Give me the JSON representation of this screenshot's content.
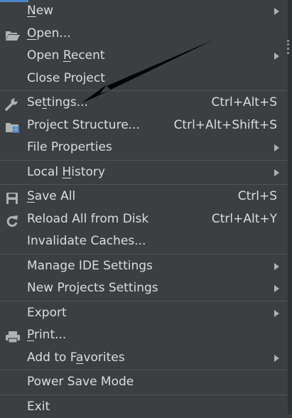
{
  "menu": {
    "items": [
      {
        "pre": "",
        "ul": "N",
        "post": "ew",
        "shortcut": "",
        "submenu": true,
        "icon": "none"
      },
      {
        "pre": "",
        "ul": "O",
        "post": "pen...",
        "shortcut": "",
        "submenu": false,
        "icon": "folder-open-icon"
      },
      {
        "pre": "Open ",
        "ul": "R",
        "post": "ecent",
        "shortcut": "",
        "submenu": true,
        "icon": "none"
      },
      {
        "pre": "Close Project",
        "ul": "",
        "post": "",
        "shortcut": "",
        "submenu": false,
        "icon": "none"
      },
      {
        "pre": "Se",
        "ul": "t",
        "post": "tings...",
        "shortcut": "Ctrl+Alt+S",
        "submenu": false,
        "icon": "wrench-icon"
      },
      {
        "pre": "Project Structure...",
        "ul": "",
        "post": "",
        "shortcut": "Ctrl+Alt+Shift+S",
        "submenu": false,
        "icon": "project-structure-icon"
      },
      {
        "pre": "File Properties",
        "ul": "",
        "post": "",
        "shortcut": "",
        "submenu": true,
        "icon": "none"
      },
      {
        "pre": "Local ",
        "ul": "H",
        "post": "istory",
        "shortcut": "",
        "submenu": true,
        "icon": "none"
      },
      {
        "pre": "",
        "ul": "S",
        "post": "ave All",
        "shortcut": "Ctrl+S",
        "submenu": false,
        "icon": "save-icon"
      },
      {
        "pre": "Reload All from Disk",
        "ul": "",
        "post": "",
        "shortcut": "Ctrl+Alt+Y",
        "submenu": false,
        "icon": "reload-icon"
      },
      {
        "pre": "Invalidate Caches...",
        "ul": "",
        "post": "",
        "shortcut": "",
        "submenu": false,
        "icon": "none"
      },
      {
        "pre": "Manage IDE Settings",
        "ul": "",
        "post": "",
        "shortcut": "",
        "submenu": true,
        "icon": "none"
      },
      {
        "pre": "New Projects Settings",
        "ul": "",
        "post": "",
        "shortcut": "",
        "submenu": true,
        "icon": "none"
      },
      {
        "pre": "Export",
        "ul": "",
        "post": "",
        "shortcut": "",
        "submenu": true,
        "icon": "none"
      },
      {
        "pre": "",
        "ul": "P",
        "post": "rint...",
        "shortcut": "",
        "submenu": false,
        "icon": "printer-icon"
      },
      {
        "pre": "Add to F",
        "ul": "a",
        "post": "vorites",
        "shortcut": "",
        "submenu": true,
        "icon": "none"
      },
      {
        "pre": "Power Save Mode",
        "ul": "",
        "post": "",
        "shortcut": "",
        "submenu": false,
        "icon": "none"
      },
      {
        "pre": "E",
        "ul": "",
        "post": "xit",
        "shortcut": "",
        "submenu": false,
        "icon": "none"
      }
    ]
  },
  "colors": {
    "background": "#3c3f41",
    "text": "#dcdcdc",
    "separator": "#515151",
    "icon": "#afb1b3",
    "accent_blue": "#4a88c7",
    "annotation_arrow": "#000000"
  }
}
